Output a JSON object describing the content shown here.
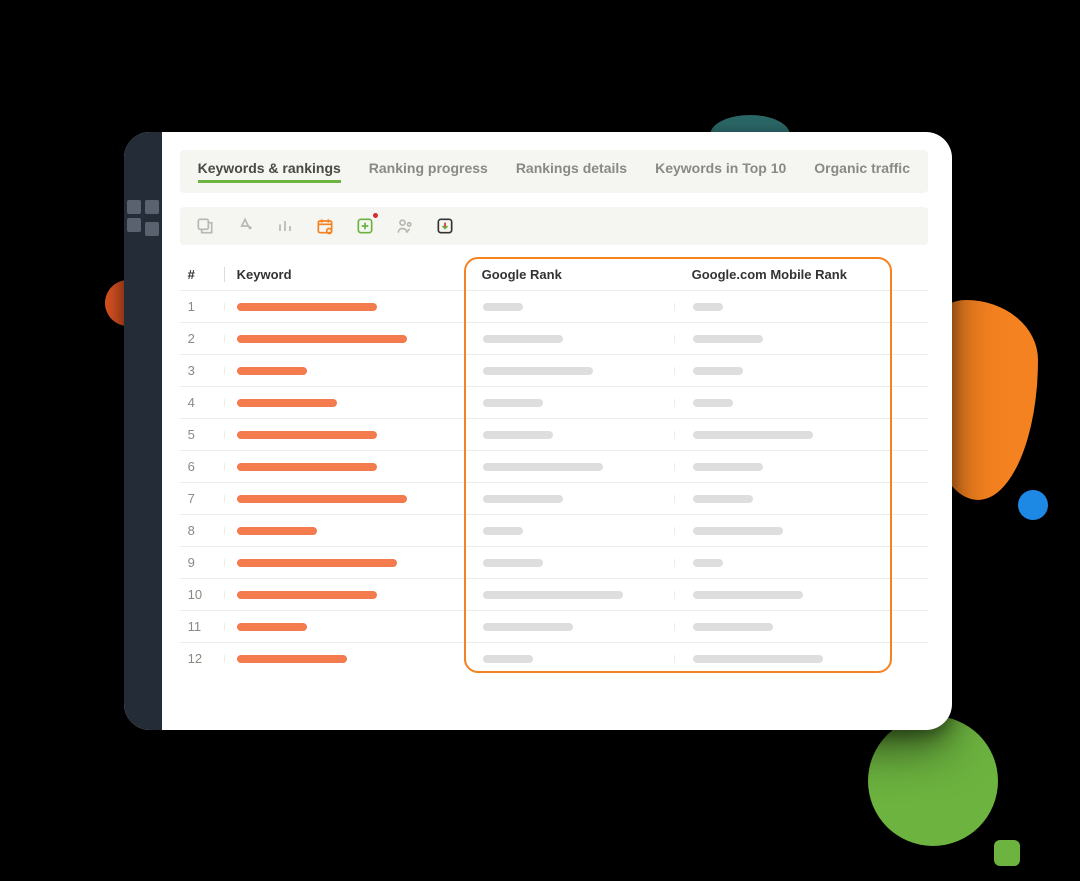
{
  "tabs": [
    {
      "label": "Keywords & rankings",
      "active": true
    },
    {
      "label": "Ranking progress",
      "active": false
    },
    {
      "label": "Rankings details",
      "active": false
    },
    {
      "label": "Keywords in Top 10",
      "active": false
    },
    {
      "label": "Organic traffic",
      "active": false
    }
  ],
  "columns": {
    "index": "#",
    "keyword": "Keyword",
    "google_rank": "Google Rank",
    "google_mobile_rank": "Google.com Mobile Rank"
  },
  "toolbar_icons": [
    "share-icon",
    "person-add-icon",
    "chart-icon",
    "schedule-icon",
    "add-box-icon",
    "team-icon",
    "download-icon"
  ],
  "rows": [
    {
      "n": 1,
      "kw_w": 140,
      "gr_w": 40,
      "gmr_w": 30
    },
    {
      "n": 2,
      "kw_w": 170,
      "gr_w": 80,
      "gmr_w": 70
    },
    {
      "n": 3,
      "kw_w": 70,
      "gr_w": 110,
      "gmr_w": 50
    },
    {
      "n": 4,
      "kw_w": 100,
      "gr_w": 60,
      "gmr_w": 40
    },
    {
      "n": 5,
      "kw_w": 140,
      "gr_w": 70,
      "gmr_w": 120
    },
    {
      "n": 6,
      "kw_w": 140,
      "gr_w": 120,
      "gmr_w": 70
    },
    {
      "n": 7,
      "kw_w": 170,
      "gr_w": 80,
      "gmr_w": 60
    },
    {
      "n": 8,
      "kw_w": 80,
      "gr_w": 40,
      "gmr_w": 90
    },
    {
      "n": 9,
      "kw_w": 160,
      "gr_w": 60,
      "gmr_w": 30
    },
    {
      "n": 10,
      "kw_w": 140,
      "gr_w": 140,
      "gmr_w": 110
    },
    {
      "n": 11,
      "kw_w": 70,
      "gr_w": 90,
      "gmr_w": 80
    },
    {
      "n": 12,
      "kw_w": 110,
      "gr_w": 50,
      "gmr_w": 130
    }
  ],
  "colors": {
    "accent_orange": "#f58220",
    "bar_orange": "#f47b4e",
    "accent_green": "#6cb33f"
  }
}
